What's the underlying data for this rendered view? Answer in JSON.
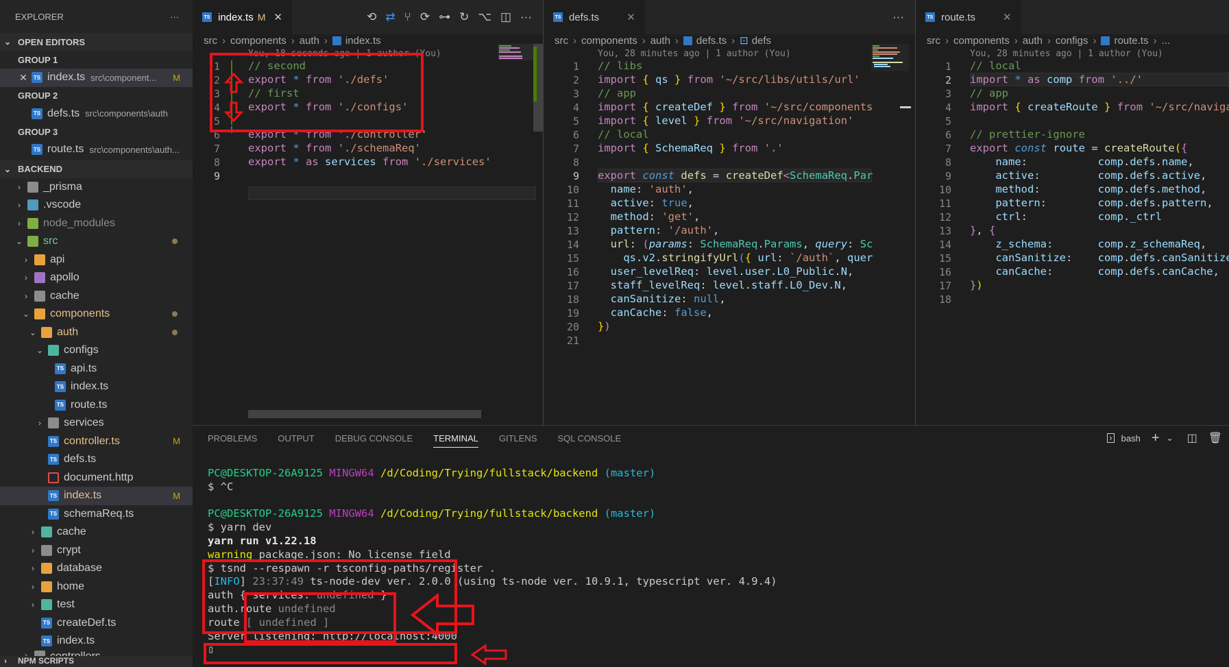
{
  "sidebar": {
    "title": "EXPLORER",
    "more": "···",
    "open_editors": "OPEN EDITORS",
    "groups": [
      {
        "label": "GROUP 1",
        "file": "index.ts",
        "desc": "src\\component...",
        "badge": "M"
      },
      {
        "label": "GROUP 2",
        "file": "defs.ts",
        "desc": "src\\components\\auth"
      },
      {
        "label": "GROUP 3",
        "file": "route.ts",
        "desc": "src\\components\\auth..."
      }
    ],
    "backend": "BACKEND",
    "tree": [
      {
        "label": "_prisma"
      },
      {
        "label": ".vscode"
      },
      {
        "label": "node_modules"
      },
      {
        "label": "src"
      },
      {
        "label": "api"
      },
      {
        "label": "apollo"
      },
      {
        "label": "cache"
      },
      {
        "label": "components"
      },
      {
        "label": "auth"
      },
      {
        "label": "configs"
      },
      {
        "label": "api.ts"
      },
      {
        "label": "index.ts"
      },
      {
        "label": "route.ts"
      },
      {
        "label": "services"
      },
      {
        "label": "controller.ts",
        "badge": "M"
      },
      {
        "label": "defs.ts"
      },
      {
        "label": "document.http"
      },
      {
        "label": "index.ts",
        "badge": "M"
      },
      {
        "label": "schemaReq.ts"
      },
      {
        "label": "cache"
      },
      {
        "label": "crypt"
      },
      {
        "label": "database"
      },
      {
        "label": "home"
      },
      {
        "label": "test"
      },
      {
        "label": "createDef.ts"
      },
      {
        "label": "index.ts"
      },
      {
        "label": "controllers"
      }
    ],
    "npm_scripts": "NPM SCRIPTS"
  },
  "editor1": {
    "tab": "index.ts",
    "tab_mod": "M",
    "crumbs": [
      "src",
      "components",
      "auth",
      "index.ts"
    ],
    "blame": "You, 18 seconds ago | 1 author (You)",
    "lines": [
      "1",
      "2",
      "3",
      "4",
      "5",
      "6",
      "7",
      "8",
      "9"
    ]
  },
  "editor2": {
    "tab": "defs.ts",
    "crumbs": [
      "src",
      "components",
      "auth",
      "defs.ts",
      "defs"
    ],
    "blame": "You, 28 minutes ago | 1 author (You)",
    "lines": [
      "1",
      "2",
      "3",
      "4",
      "5",
      "6",
      "7",
      "8",
      "9",
      "10",
      "11",
      "12",
      "13",
      "14",
      "15",
      "16",
      "17",
      "18",
      "19",
      "20",
      "21"
    ]
  },
  "editor3": {
    "tab": "route.ts",
    "crumbs": [
      "src",
      "components",
      "auth",
      "configs",
      "route.ts",
      "..."
    ],
    "blame": "You, 28 minutes ago | 1 author (You)",
    "lines": [
      "1",
      "2",
      "3",
      "4",
      "5",
      "6",
      "7",
      "8",
      "9",
      "10",
      "11",
      "12",
      "13",
      "14",
      "15",
      "16",
      "17",
      "18"
    ]
  },
  "panel": {
    "tabs": [
      "PROBLEMS",
      "OUTPUT",
      "DEBUG CONSOLE",
      "TERMINAL",
      "GITLENS",
      "SQL CONSOLE"
    ],
    "shell": "bash"
  },
  "terminal": {
    "user": "PC@DESKTOP-26A9125",
    "env": "MINGW64",
    "path": "/d/Coding/Trying/fullstack/backend",
    "branch": "(master)",
    "line_ctrlc": "$ ^C",
    "line_cmd": "$ yarn dev",
    "line_yarn": "yarn run v1.22.18",
    "warning_word": "warning",
    "warning_rest": " package.json: No license field",
    "tsnd": "$ tsnd --respawn -r tsconfig-paths/register .",
    "info_open": "[",
    "info_word": "INFO",
    "info_close": "]",
    "info_time": " 23:37:49",
    "info_rest": " ts-node-dev ver. 2.0.0 (using ts-node ver. 10.9.1, typescript ver. 4.9.4)",
    "auth_a": "auth ",
    "auth_b": "{ services: ",
    "auth_c": "undefined",
    "auth_d": " }",
    "route_a": "auth.route ",
    "route_b": "undefined",
    "routes_a": "route ",
    "routes_b": "[ undefined ]",
    "server": "Server listening: http://localhost:4000",
    "cursor": "▯"
  },
  "colors": {
    "annotation": "#e8131b",
    "ts_blue": "#3178c6"
  }
}
